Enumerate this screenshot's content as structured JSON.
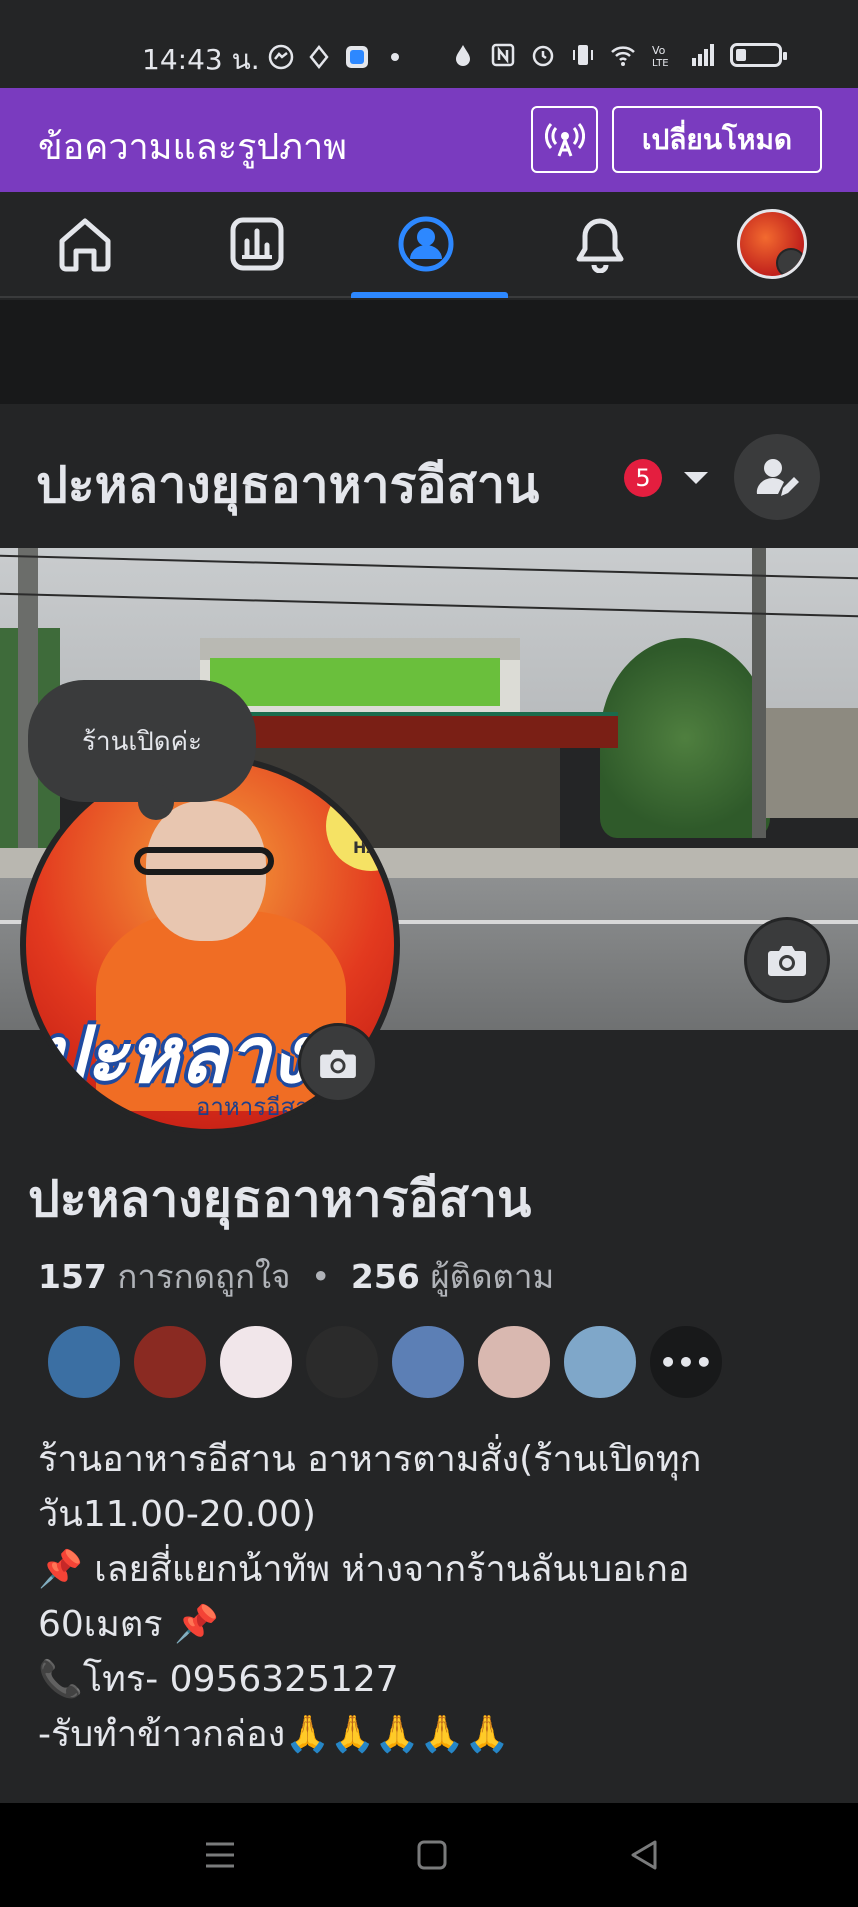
{
  "status_bar": {
    "time": "14:43 น.",
    "icons_left": [
      "messenger-icon",
      "drop-icon",
      "app-icon",
      "dot-icon"
    ],
    "icons_right": [
      "water-drop-icon",
      "nfc-icon",
      "alarm-icon",
      "vibrate-icon",
      "wifi-icon",
      "volte-icon",
      "signal-icon",
      "battery-icon"
    ]
  },
  "mode_bar": {
    "title": "ข้อความและรูปภาพ",
    "switch_label": "เปลี่ยนโหมด",
    "accent_color": "#7a3bbf"
  },
  "tabs": [
    {
      "name": "home",
      "icon": "home-icon"
    },
    {
      "name": "insights",
      "icon": "chart-icon"
    },
    {
      "name": "profile",
      "icon": "profile-icon",
      "active": true
    },
    {
      "name": "notifications",
      "icon": "bell-icon"
    },
    {
      "name": "menu",
      "icon": "avatar-menu-icon"
    }
  ],
  "page_header": {
    "name": "ปะหลางยุธอาหารอีสาน",
    "badge_count": "5"
  },
  "note": {
    "text": "ร้านเปิดค่ะ"
  },
  "profile": {
    "logo_text": "ปะหลางยุธ",
    "logo_sub": "อาหารอีสาน",
    "halal_label": "HAL",
    "name": "ปะหลางยุธอาหารอีสาน",
    "likes_count": "157",
    "likes_label": "การกดถูกใจ",
    "separator": "•",
    "followers_count": "256",
    "followers_label": "ผู้ติดตาม",
    "follower_avatar_colors": [
      "#3b6fa3",
      "#8a2a22",
      "#f1e6ea",
      "#2b2b2b",
      "#5c7fb5",
      "#d9b8b0",
      "#7fa7c9"
    ],
    "more_label": "•••",
    "bio_lines": [
      "ร้านอาหารอีสาน อาหารตามสั่ง(ร้านเปิดทุก",
      "วัน11.00-20.00)",
      "📌 เลยสี่แยกน้าทัพ ห่างจากร้านลันเบอเกอ",
      "60เมตร  📌",
      " 📞โทร- 0956325127",
      "-รับทำข้าวกล่อง🙏🙏🙏🙏🙏"
    ]
  },
  "nav": [
    "recents-icon",
    "home-button-icon",
    "back-icon"
  ]
}
